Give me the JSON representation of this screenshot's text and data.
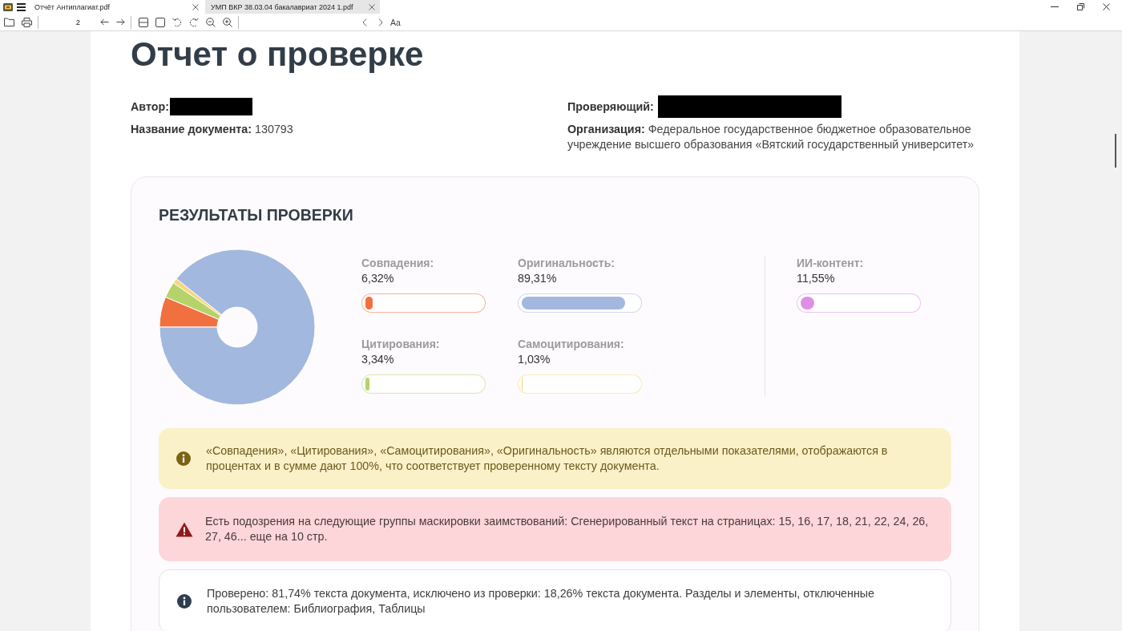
{
  "tabs": [
    {
      "label": "Отчёт Антиплагиат.pdf",
      "selected": true
    },
    {
      "label": "УМП ВКР 38.03.04 бакалавриат 2024 1.pdf",
      "selected": false
    }
  ],
  "toolbar": {
    "page_number": "2",
    "text_button": "Aa"
  },
  "report": {
    "title": "Отчет о проверке",
    "author_label": "Автор:",
    "reviewer_label": "Проверяющий:",
    "document_name": "**Название документа:** 130793",
    "organization": "**Организация:** Федеральное государственное бюджетное образовательное учреждение высшего образования «Вятский государственный университет»"
  },
  "results": {
    "heading": "РЕЗУЛЬТАТЫ ПРОВЕРКИ",
    "chart_data": {
      "type": "donut",
      "values": [
        6.32,
        3.34,
        1.03,
        89.31
      ],
      "colors": [
        "#f07040",
        "#b5d36a",
        "#f5d77a",
        "#a3b8de"
      ]
    },
    "metrics": [
      {
        "label": "Совпадения:",
        "value": "6,32%",
        "level": 0.0632,
        "color": "#f07040"
      },
      {
        "label": "Оригинальность:",
        "value": "89,31%",
        "level": 0.8931,
        "color": "#a3b8de"
      },
      {
        "label": "Цитирования:",
        "value": "3,34%",
        "level": 0.0334,
        "color": "#b5d36a"
      },
      {
        "label": "Самоцитирования:",
        "value": "1,03%",
        "level": 0.0103,
        "color": "#f5d77a"
      }
    ],
    "ai_content": {
      "label": "ИИ-контент:",
      "value": "11,55%",
      "level": 0.1155,
      "color": "#e08ee8"
    }
  },
  "notices": [
    {
      "kind": "info",
      "text": "«Совпадения», «Цитирования», «Самоцитирования», «Оригинальность» являются отдельными показателями, отображаются в процентах и в сумме дают 100%, что соответствует проверенному тексту документа."
    },
    {
      "kind": "warning",
      "text": "Есть подозрения на следующие группы маскировки заимствований: Сгенерированный текст на страницах: 15, 16, 17, 18, 21, 22, 24, 26, 27, 46... еще на 10 стр."
    },
    {
      "kind": "note",
      "text": "Проверено: 81,74% текста документа, исключено из проверки: 18,26% текста документа. Разделы и элементы, отключенные пользователем: Библиография, Таблицы"
    }
  ]
}
